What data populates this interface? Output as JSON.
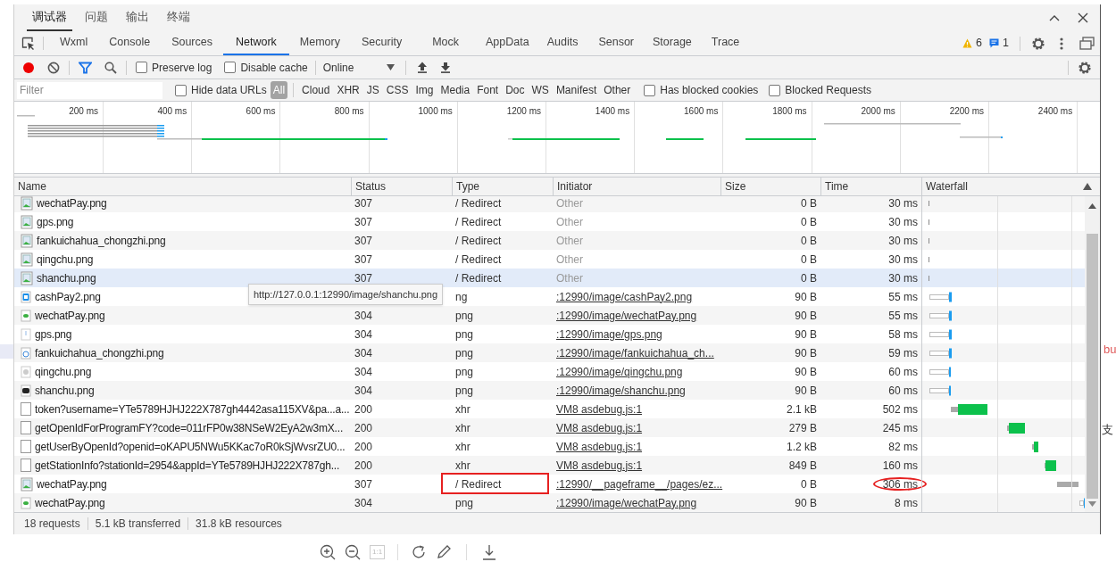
{
  "top_tabs": [
    {
      "label": "调试器",
      "selected": true
    },
    {
      "label": "问题",
      "selected": false
    },
    {
      "label": "输出",
      "selected": false
    },
    {
      "label": "终端",
      "selected": false
    }
  ],
  "tabs": [
    {
      "label": "Wxml",
      "selected": false
    },
    {
      "label": "Console",
      "selected": false
    },
    {
      "label": "Sources",
      "selected": false
    },
    {
      "label": "Network",
      "selected": true
    },
    {
      "label": "Memory",
      "selected": false
    },
    {
      "label": "Security",
      "selected": false
    },
    {
      "label": "Mock",
      "selected": false
    },
    {
      "label": "AppData",
      "selected": false
    },
    {
      "label": "Audits",
      "selected": false
    },
    {
      "label": "Sensor",
      "selected": false
    },
    {
      "label": "Storage",
      "selected": false
    },
    {
      "label": "Trace",
      "selected": false
    }
  ],
  "badges": {
    "warnings": "6",
    "messages": "1"
  },
  "toolbar": {
    "recording": true,
    "filter_active": true,
    "checkboxes": [
      {
        "label": "Preserve log",
        "checked": false
      },
      {
        "label": "Disable cache",
        "checked": false
      }
    ],
    "throttling": "Online"
  },
  "filter": {
    "placeholder": "Filter",
    "hide_data_urls": {
      "label": "Hide data URLs",
      "checked": false
    },
    "types": [
      {
        "label": "All",
        "selected": true
      },
      {
        "label": "Cloud",
        "selected": false
      },
      {
        "label": "XHR",
        "selected": false
      },
      {
        "label": "JS",
        "selected": false
      },
      {
        "label": "CSS",
        "selected": false
      },
      {
        "label": "Img",
        "selected": false
      },
      {
        "label": "Media",
        "selected": false
      },
      {
        "label": "Font",
        "selected": false
      },
      {
        "label": "Doc",
        "selected": false
      },
      {
        "label": "WS",
        "selected": false
      },
      {
        "label": "Manifest",
        "selected": false
      },
      {
        "label": "Other",
        "selected": false
      }
    ],
    "extra_checkboxes": [
      {
        "label": "Has blocked cookies",
        "checked": false
      },
      {
        "label": "Blocked Requests",
        "checked": false
      }
    ]
  },
  "overview": {
    "ticks": [
      "200 ms",
      "400 ms",
      "600 ms",
      "800 ms",
      "1000 ms",
      "1200 ms",
      "1400 ms",
      "1600 ms",
      "1800 ms",
      "2000 ms",
      "2200 ms",
      "2400 ms"
    ]
  },
  "table": {
    "columns": [
      "Name",
      "Status",
      "Type",
      "Initiator",
      "Size",
      "Time",
      "Waterfall"
    ],
    "rows": [
      {
        "kind": "redirect",
        "name": "wechatPay.png",
        "status": "307",
        "type": "/ Redirect",
        "initiator": "Other",
        "initiator_link": false,
        "size": "0 B",
        "time": "30 ms",
        "selected": false,
        "type_boxed": false,
        "time_circled": false
      },
      {
        "kind": "redirect",
        "name": "gps.png",
        "status": "307",
        "type": "/ Redirect",
        "initiator": "Other",
        "initiator_link": false,
        "size": "0 B",
        "time": "30 ms",
        "selected": false,
        "type_boxed": false,
        "time_circled": false
      },
      {
        "kind": "redirect",
        "name": "fankuichahua_chongzhi.png",
        "status": "307",
        "type": "/ Redirect",
        "initiator": "Other",
        "initiator_link": false,
        "size": "0 B",
        "time": "30 ms",
        "selected": false,
        "type_boxed": false,
        "time_circled": false
      },
      {
        "kind": "redirect",
        "name": "qingchu.png",
        "status": "307",
        "type": "/ Redirect",
        "initiator": "Other",
        "initiator_link": false,
        "size": "0 B",
        "time": "30 ms",
        "selected": false,
        "type_boxed": false,
        "time_circled": false
      },
      {
        "kind": "redirect",
        "name": "shanchu.png",
        "status": "307",
        "type": "/ Redirect",
        "initiator": "Other",
        "initiator_link": false,
        "size": "0 B",
        "time": "30 ms",
        "selected": true,
        "type_boxed": false,
        "time_circled": false
      },
      {
        "kind": "image",
        "name": "cashPay2.png",
        "type": "ng",
        "initiator": ":12990/image/cashPay2.png",
        "initiator_link": true,
        "size": "90 B",
        "time": "55 ms",
        "selected": false,
        "type_boxed": false,
        "time_circled": false
      },
      {
        "kind": "image",
        "name": "wechatPay.png",
        "status": "304",
        "type": "png",
        "initiator": ":12990/image/wechatPay.png",
        "initiator_link": true,
        "size": "90 B",
        "time": "55 ms",
        "selected": false,
        "type_boxed": false,
        "time_circled": false
      },
      {
        "kind": "image",
        "name": "gps.png",
        "status": "304",
        "type": "png",
        "initiator": ":12990/image/gps.png",
        "initiator_link": true,
        "size": "90 B",
        "time": "58 ms",
        "selected": false,
        "type_boxed": false,
        "time_circled": false
      },
      {
        "kind": "image",
        "name": "fankuichahua_chongzhi.png",
        "status": "304",
        "type": "png",
        "initiator": ":12990/image/fankuichahua_ch...",
        "initiator_link": true,
        "size": "90 B",
        "time": "59 ms",
        "selected": false,
        "type_boxed": false,
        "time_circled": false
      },
      {
        "kind": "image",
        "name": "qingchu.png",
        "status": "304",
        "type": "png",
        "initiator": ":12990/image/qingchu.png",
        "initiator_link": true,
        "size": "90 B",
        "time": "60 ms",
        "selected": false,
        "type_boxed": false,
        "time_circled": false
      },
      {
        "kind": "image",
        "name": "shanchu.png",
        "status": "304",
        "type": "png",
        "initiator": ":12990/image/shanchu.png",
        "initiator_link": true,
        "size": "90 B",
        "time": "60 ms",
        "selected": false,
        "type_boxed": false,
        "time_circled": false
      },
      {
        "kind": "xhr",
        "name": "token?username=YTe5789HJHJ222X787gh4442asa115XV&pa...a...",
        "status": "200",
        "type": "xhr",
        "initiator": "VM8 asdebug.js:1",
        "initiator_link": true,
        "size": "2.1 kB",
        "time": "502 ms",
        "selected": false,
        "type_boxed": false,
        "time_circled": false
      },
      {
        "kind": "xhr",
        "name": "getOpenIdForProgramFY?code=011rFP0w38NSeW2EyA2w3mX...",
        "status": "200",
        "type": "xhr",
        "initiator": "VM8 asdebug.js:1",
        "initiator_link": true,
        "size": "279 B",
        "time": "245 ms",
        "selected": false,
        "type_boxed": false,
        "time_circled": false
      },
      {
        "kind": "xhr",
        "name": "getUserByOpenId?openid=oKAPU5NWu5KKac7oR0kSjWvsrZU0...",
        "status": "200",
        "type": "xhr",
        "initiator": "VM8 asdebug.js:1",
        "initiator_link": true,
        "size": "1.2 kB",
        "time": "82 ms",
        "selected": false,
        "type_boxed": false,
        "time_circled": false
      },
      {
        "kind": "xhr",
        "name": "getStationInfo?stationId=2954&appId=YTe5789HJHJ222X787gh...",
        "status": "200",
        "type": "xhr",
        "initiator": "VM8 asdebug.js:1",
        "initiator_link": true,
        "size": "849 B",
        "time": "160 ms",
        "selected": false,
        "type_boxed": false,
        "time_circled": false
      },
      {
        "kind": "redirect",
        "name": "wechatPay.png",
        "status": "307",
        "type": "/ Redirect",
        "initiator": ":12990/__pageframe__/pages/ez...",
        "initiator_link": true,
        "size": "0 B",
        "time": "306 ms",
        "selected": false,
        "type_boxed": true,
        "time_circled": true
      },
      {
        "kind": "image",
        "name": "wechatPay.png",
        "status": "304",
        "type": "png",
        "initiator": ":12990/image/wechatPay.png",
        "initiator_link": true,
        "size": "90 B",
        "time": "8 ms",
        "selected": false,
        "type_boxed": false,
        "time_circled": false
      }
    ]
  },
  "tooltip": "http://127.0.0.1:12990/image/shanchu.png",
  "status_bar": [
    "18 requests",
    "5.1 kB transferred",
    "31.8 kB resources"
  ],
  "zoom_label": "1:1",
  "page_fragments": [
    "bu",
    "支"
  ]
}
